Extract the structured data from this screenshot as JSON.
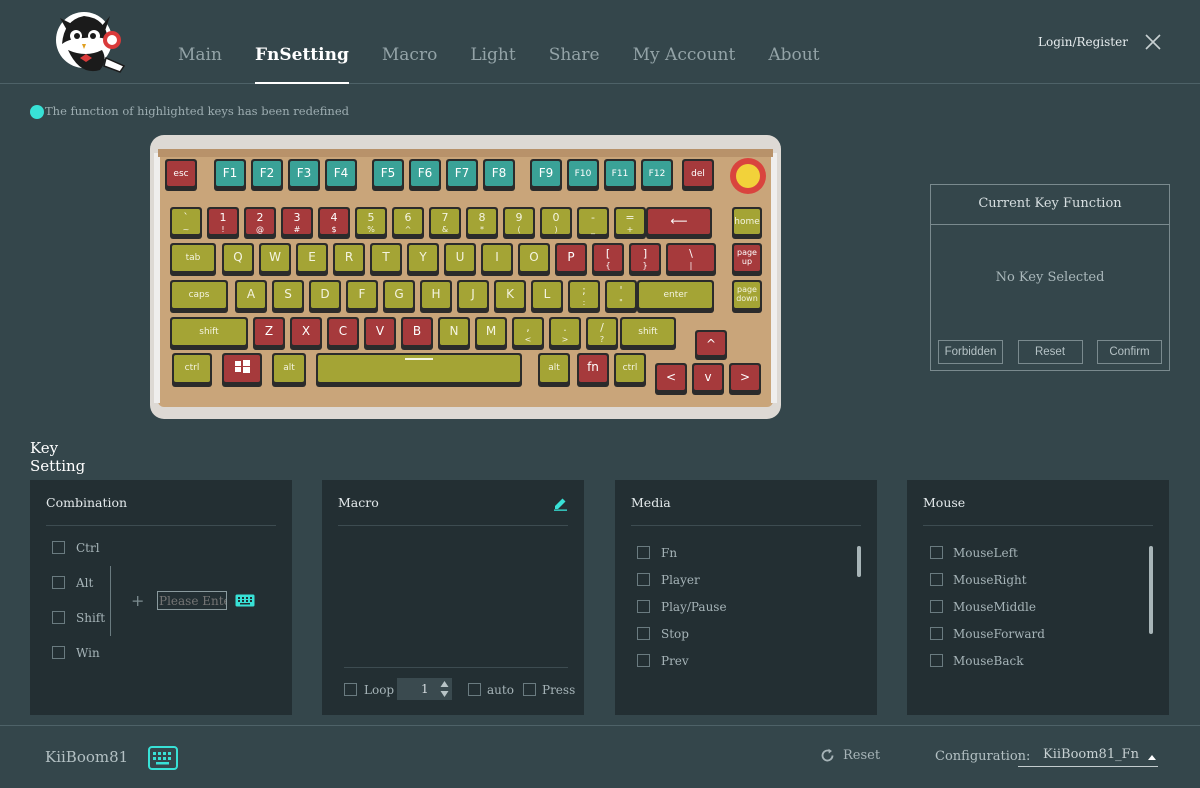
{
  "header": {
    "nav": [
      "Main",
      "FnSetting",
      "Macro",
      "Light",
      "Share",
      "My Account",
      "About"
    ],
    "active_tab": "FnSetting",
    "login_label": "Login/Register"
  },
  "notice": {
    "text": "The function of highlighted keys has been redefined",
    "dot_color": "#38e1d6"
  },
  "keyboard": {
    "colors": {
      "red": "#a63a3c",
      "olive": "#a4a435",
      "teal": "#3aa297",
      "case": "#c9a57a"
    },
    "rows": [
      [
        [
          "esc",
          "",
          "red"
        ],
        [
          "F1",
          "",
          "teal"
        ],
        [
          "F2",
          "",
          "teal"
        ],
        [
          "F3",
          "",
          "teal"
        ],
        [
          "F4",
          "",
          "teal"
        ],
        [
          "F5",
          "",
          "teal"
        ],
        [
          "F6",
          "",
          "teal"
        ],
        [
          "F7",
          "",
          "teal"
        ],
        [
          "F8",
          "",
          "teal"
        ],
        [
          "F9",
          "",
          "teal"
        ],
        [
          "F10",
          "",
          "teal"
        ],
        [
          "F11",
          "",
          "teal"
        ],
        [
          "F12",
          "",
          "teal"
        ],
        [
          "del",
          "",
          "red"
        ]
      ],
      [
        [
          "`",
          "~",
          "olive"
        ],
        [
          "1",
          "!",
          "red"
        ],
        [
          "2",
          "@",
          "red"
        ],
        [
          "3",
          "#",
          "red"
        ],
        [
          "4",
          "$",
          "red"
        ],
        [
          "5",
          "%",
          "olive"
        ],
        [
          "6",
          "^",
          "olive"
        ],
        [
          "7",
          "&",
          "olive"
        ],
        [
          "8",
          "*",
          "olive"
        ],
        [
          "9",
          "(",
          "olive"
        ],
        [
          "0",
          ")",
          "olive"
        ],
        [
          "-",
          "_",
          "olive"
        ],
        [
          "=",
          "+",
          "olive"
        ],
        [
          "⟵",
          "",
          "red"
        ],
        [
          "home",
          "",
          "olive"
        ]
      ],
      [
        [
          "tab",
          "",
          "olive"
        ],
        [
          "Q",
          "",
          "olive"
        ],
        [
          "W",
          "",
          "olive"
        ],
        [
          "E",
          "",
          "olive"
        ],
        [
          "R",
          "",
          "olive"
        ],
        [
          "T",
          "",
          "olive"
        ],
        [
          "Y",
          "",
          "olive"
        ],
        [
          "U",
          "",
          "olive"
        ],
        [
          "I",
          "",
          "olive"
        ],
        [
          "O",
          "",
          "olive"
        ],
        [
          "P",
          "",
          "red"
        ],
        [
          "[",
          "{",
          "red"
        ],
        [
          "]",
          "}",
          "red"
        ],
        [
          "\\",
          "|",
          "red"
        ],
        [
          "page up",
          "",
          "red"
        ]
      ],
      [
        [
          "caps",
          "",
          "olive"
        ],
        [
          "A",
          "",
          "olive"
        ],
        [
          "S",
          "",
          "olive"
        ],
        [
          "D",
          "",
          "olive"
        ],
        [
          "F",
          "",
          "olive"
        ],
        [
          "G",
          "",
          "olive"
        ],
        [
          "H",
          "",
          "olive"
        ],
        [
          "J",
          "",
          "olive"
        ],
        [
          "K",
          "",
          "olive"
        ],
        [
          "L",
          "",
          "olive"
        ],
        [
          ";",
          ":",
          "olive"
        ],
        [
          "'",
          "\"",
          "olive"
        ],
        [
          "enter",
          "",
          "olive"
        ],
        [
          "page down",
          "",
          "olive"
        ]
      ],
      [
        [
          "shift",
          "",
          "olive"
        ],
        [
          "Z",
          "",
          "red"
        ],
        [
          "X",
          "",
          "red"
        ],
        [
          "C",
          "",
          "red"
        ],
        [
          "V",
          "",
          "red"
        ],
        [
          "B",
          "",
          "red"
        ],
        [
          "N",
          "",
          "olive"
        ],
        [
          "M",
          "",
          "olive"
        ],
        [
          ",",
          "<",
          "olive"
        ],
        [
          ".",
          ">",
          "olive"
        ],
        [
          "/",
          "?",
          "olive"
        ],
        [
          "shift",
          "",
          "olive"
        ],
        [
          "^",
          "",
          "red"
        ]
      ],
      [
        [
          "ctrl",
          "",
          "olive"
        ],
        [
          "",
          "",
          "red"
        ],
        [
          "alt",
          "",
          "olive"
        ],
        [
          "",
          "",
          "olive"
        ],
        [
          "alt",
          "",
          "olive"
        ],
        [
          "fn",
          "",
          "red"
        ],
        [
          "ctrl",
          "",
          "olive"
        ],
        [
          "<",
          "",
          "red"
        ],
        [
          "v",
          "",
          "red"
        ],
        [
          ">",
          "",
          "red"
        ]
      ]
    ]
  },
  "current_key": {
    "title": "Current Key Function",
    "status": "No Key Selected",
    "buttons": [
      "Forbidden",
      "Reset",
      "Confirm"
    ]
  },
  "key_setting": {
    "title": "Key Setting",
    "combination": {
      "title": "Combination",
      "modifiers": [
        "Ctrl",
        "Alt",
        "Shift",
        "Win"
      ],
      "input_placeholder": "Please Enter"
    },
    "macro": {
      "title": "Macro",
      "loop_label": "Loop",
      "loop_value": "1",
      "auto_label": "auto",
      "press_label": "Press"
    },
    "media": {
      "title": "Media",
      "items": [
        "Fn",
        "Player",
        "Play/Pause",
        "Stop",
        "Prev"
      ]
    },
    "mouse": {
      "title": "Mouse",
      "items": [
        "MouseLeft",
        "MouseRight",
        "MouseMiddle",
        "MouseForward",
        "MouseBack"
      ]
    }
  },
  "footer": {
    "device_name": "KiiBoom81",
    "reset_label": "Reset",
    "config_label": "Configuration:",
    "config_value": "KiiBoom81_Fn"
  },
  "accent_color": "#38e1d6"
}
